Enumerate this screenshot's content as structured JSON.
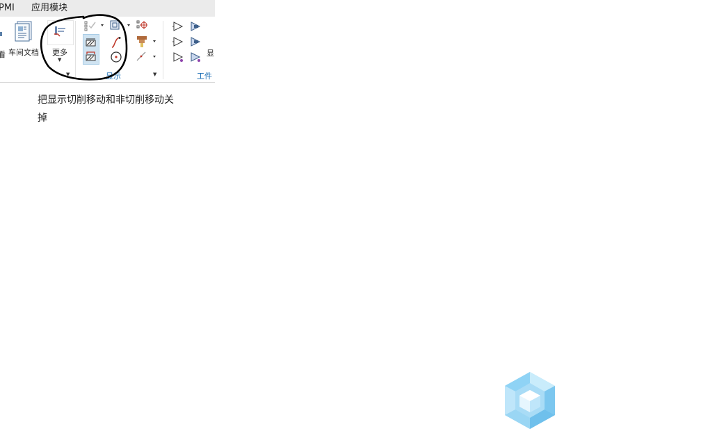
{
  "menubar": {
    "partial_tab": "PMI",
    "app_modules": "应用模块"
  },
  "ribbon": {
    "partial_left_label": "看",
    "shop_doc_label": "车间文档",
    "more_label": "更多",
    "display_group_label": "显示",
    "workpiece_partial_label": "显",
    "workpiece_group_label": "工件"
  },
  "annotation": {
    "note_line1": "把显示切削移动和非切削移动关",
    "note_line2": "掉"
  },
  "colors": {
    "group_label": "#1c6fb5",
    "circle": "#000000",
    "logo": "#8fd3f5"
  }
}
